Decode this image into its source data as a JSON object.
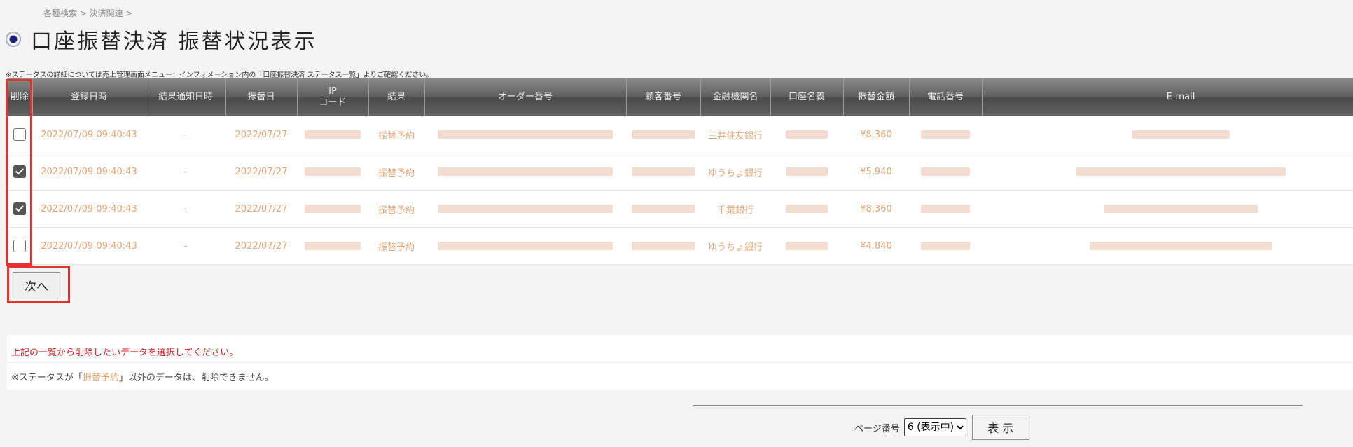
{
  "breadcrumb": "各種検索 > 決済関連 >",
  "page_title": "口座振替決済 振替状況表示",
  "note": "※ステータスの詳細については売上管理画面メニュー：インフォメーション内の「口座振替決済 ステータス一覧」よりご確認ください。",
  "table": {
    "headers": {
      "delete": "削除",
      "registered": "登録日時",
      "notified": "結果通知日時",
      "transfer_date": "振替日",
      "ip_line1": "IP",
      "ip_line2": "コード",
      "result": "結果",
      "order_no": "オーダー番号",
      "customer_no": "顧客番号",
      "bank_name": "金融機関名",
      "account_name": "口座名義",
      "amount": "振替金額",
      "phone": "電話番号",
      "email": "E-mail"
    },
    "rows": [
      {
        "checked": false,
        "registered": "2022/07/09 09:40:43",
        "notified": "-",
        "transfer_date": "2022/07/27",
        "result": "振替予約",
        "bank_name": "三井住友銀行",
        "amount": "¥8,360"
      },
      {
        "checked": true,
        "registered": "2022/07/09 09:40:43",
        "notified": "-",
        "transfer_date": "2022/07/27",
        "result": "振替予約",
        "bank_name": "ゆうちょ銀行",
        "amount": "¥5,940"
      },
      {
        "checked": true,
        "registered": "2022/07/09 09:40:43",
        "notified": "-",
        "transfer_date": "2022/07/27",
        "result": "振替予約",
        "bank_name": "千葉銀行",
        "amount": "¥8,360"
      },
      {
        "checked": false,
        "registered": "2022/07/09 09:40:43",
        "notified": "-",
        "transfer_date": "2022/07/27",
        "result": "振替予約",
        "bank_name": "ゆうちょ銀行",
        "amount": "¥4,840"
      }
    ]
  },
  "next_button": "次へ",
  "info": {
    "select_prompt": "上記の一覧から削除したいデータを選択してください。",
    "status_prefix": "※ステータスが「",
    "status_em": "振替予約",
    "status_suffix": "」以外のデータは、削除できません。"
  },
  "pager": {
    "label": "ページ番号",
    "selected": "6 (表示中)",
    "show_button": "表 示"
  },
  "colors": {
    "highlight": "#e53030",
    "row_text": "#e3a676",
    "header_bg": "#5e5e5e",
    "prompt_red": "#cc2222"
  }
}
